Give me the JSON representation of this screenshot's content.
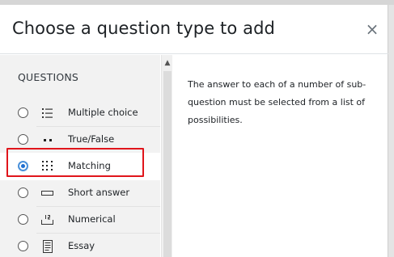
{
  "dialog": {
    "title": "Choose a question type to add",
    "close_glyph": "×"
  },
  "questions": {
    "heading": "QUESTIONS",
    "items": [
      {
        "label": "Multiple choice",
        "icon": "list-icon",
        "selected": false
      },
      {
        "label": "True/False",
        "icon": "two-dots-icon",
        "selected": false
      },
      {
        "label": "Matching",
        "icon": "dot-grid-icon",
        "selected": true
      },
      {
        "label": "Short answer",
        "icon": "input-box-icon",
        "selected": false
      },
      {
        "label": "Numerical",
        "icon": "number-input-icon",
        "selected": false
      },
      {
        "label": "Essay",
        "icon": "document-icon",
        "selected": false
      }
    ]
  },
  "description": {
    "text": "The answer to each of a number of sub-question must be selected from a list of possibilities."
  },
  "colors": {
    "highlight": "#e0151b",
    "radio_selected": "#1f6fd0"
  }
}
